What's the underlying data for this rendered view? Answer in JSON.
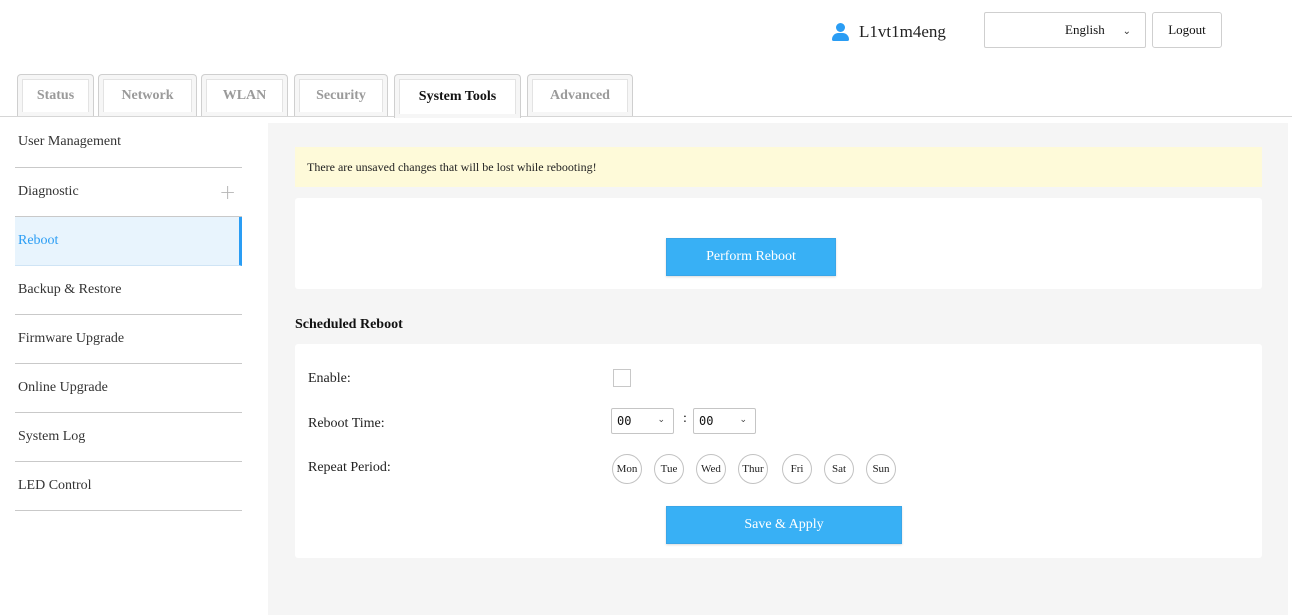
{
  "header": {
    "username": "L1vt1m4eng",
    "user_icon": "user-icon",
    "language": "English",
    "logout_label": "Logout"
  },
  "tabs": [
    {
      "label": "Status",
      "active": false
    },
    {
      "label": "Network",
      "active": false
    },
    {
      "label": "WLAN",
      "active": false
    },
    {
      "label": "Security",
      "active": false
    },
    {
      "label": "System Tools",
      "active": true
    },
    {
      "label": "Advanced",
      "active": false
    }
  ],
  "sidebar": {
    "items": [
      {
        "label": "User Management",
        "active": false
      },
      {
        "label": "Diagnostic",
        "active": false,
        "expandable": true
      },
      {
        "label": "Reboot",
        "active": true
      },
      {
        "label": "Backup & Restore",
        "active": false
      },
      {
        "label": "Firmware Upgrade",
        "active": false
      },
      {
        "label": "Online Upgrade",
        "active": false
      },
      {
        "label": "System Log",
        "active": false
      },
      {
        "label": "LED Control",
        "active": false
      }
    ],
    "expand_icon": "plus-icon"
  },
  "main": {
    "warning": "There are unsaved changes that will be lost while rebooting!",
    "perform_reboot_label": "Perform Reboot",
    "scheduled_title": "Scheduled Reboot",
    "enable_label": "Enable:",
    "enable_checked": false,
    "reboot_time_label": "Reboot Time:",
    "hour_value": "00",
    "minute_value": "00",
    "time_separator": ":",
    "repeat_period_label": "Repeat Period:",
    "days": [
      "Mon",
      "Tue",
      "Wed",
      "Thur",
      "Fri",
      "Sat",
      "Sun"
    ],
    "save_label": "Save & Apply"
  },
  "colors": {
    "accent": "#38b0f5",
    "active_sidebar_bg": "#e8f4fd",
    "warning_bg": "#fefad9",
    "content_bg": "#f5f5f5"
  }
}
